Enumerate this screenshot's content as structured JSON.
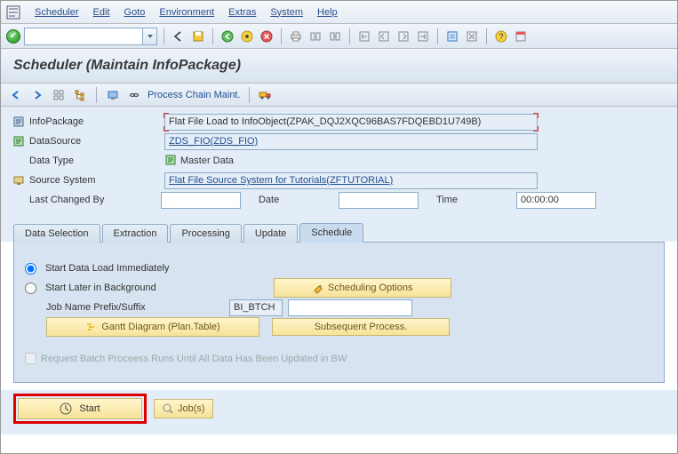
{
  "menu": {
    "items": [
      "Scheduler",
      "Edit",
      "Goto",
      "Environment",
      "Extras",
      "System",
      "Help"
    ]
  },
  "page_title": "Scheduler (Maintain InfoPackage)",
  "sub_toolbar": {
    "process_chain": "Process Chain Maint."
  },
  "form": {
    "infopackage_label": "InfoPackage",
    "infopackage_value": "Flat File Load to InfoObject(ZPAK_DQJ2XQC96BAS7FDQEBD1U749B)",
    "datasource_label": "DataSource",
    "datasource_value": "ZDS_FIO(ZDS_FIO)",
    "datatype_label": "Data Type",
    "datatype_value": "Master Data",
    "sourcesystem_label": "Source System",
    "sourcesystem_value": "Flat File Source System for Tutorials(ZFTUTORIAL)",
    "lastchanged_label": "Last Changed By",
    "lastchanged_value": "",
    "date_label": "Date",
    "date_value": "",
    "time_label": "Time",
    "time_value": "00:00:00"
  },
  "tabs": [
    "Data Selection",
    "Extraction",
    "Processing",
    "Update",
    "Schedule"
  ],
  "schedule_tab": {
    "radio_immediate": "Start Data Load Immediately",
    "radio_later": "Start Later in Background",
    "scheduling_options": "Scheduling Options",
    "job_prefix_label": "Job Name Prefix/Suffix",
    "job_prefix_value": "BI_BTCH",
    "job_suffix_value": "",
    "gantt_button": "Gantt Diagram (Plan.Table)",
    "subsequent_button": "Subsequent Process.",
    "batch_check": "Request Batch Proceess Runs Until All Data Has Been Updated in BW"
  },
  "bottom": {
    "start": "Start",
    "jobs": "Job(s)"
  }
}
